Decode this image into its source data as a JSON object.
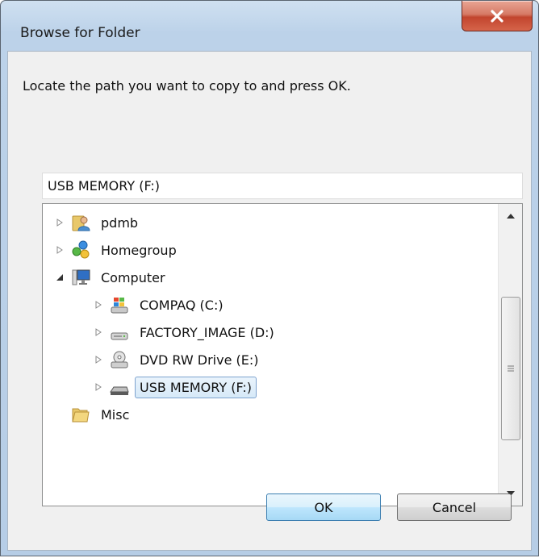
{
  "window": {
    "title": "Browse for Folder",
    "close_label": "X"
  },
  "dialog": {
    "prompt": "Locate the path you want to copy to and press OK.",
    "path_value": "USB MEMORY (F:)"
  },
  "tree": {
    "items": [
      {
        "label": "pdmb",
        "icon": "user-folder-icon",
        "expander": "collapsed"
      },
      {
        "label": "Homegroup",
        "icon": "homegroup-icon",
        "expander": "collapsed"
      },
      {
        "label": "Computer",
        "icon": "computer-icon",
        "expander": "expanded"
      },
      {
        "label": "COMPAQ (C:)",
        "icon": "windows-drive-icon",
        "expander": "collapsed"
      },
      {
        "label": "FACTORY_IMAGE (D:)",
        "icon": "hard-drive-icon",
        "expander": "collapsed"
      },
      {
        "label": "DVD RW Drive (E:)",
        "icon": "dvd-drive-icon",
        "expander": "collapsed"
      },
      {
        "label": "USB MEMORY (F:)",
        "icon": "usb-drive-icon",
        "expander": "collapsed",
        "selected": true
      },
      {
        "label": "Misc",
        "icon": "folder-icon",
        "expander": "none"
      }
    ]
  },
  "buttons": {
    "ok": "OK",
    "cancel": "Cancel"
  },
  "colors": {
    "selection_border": "#7da2ce",
    "close_button": "#c2452e"
  }
}
